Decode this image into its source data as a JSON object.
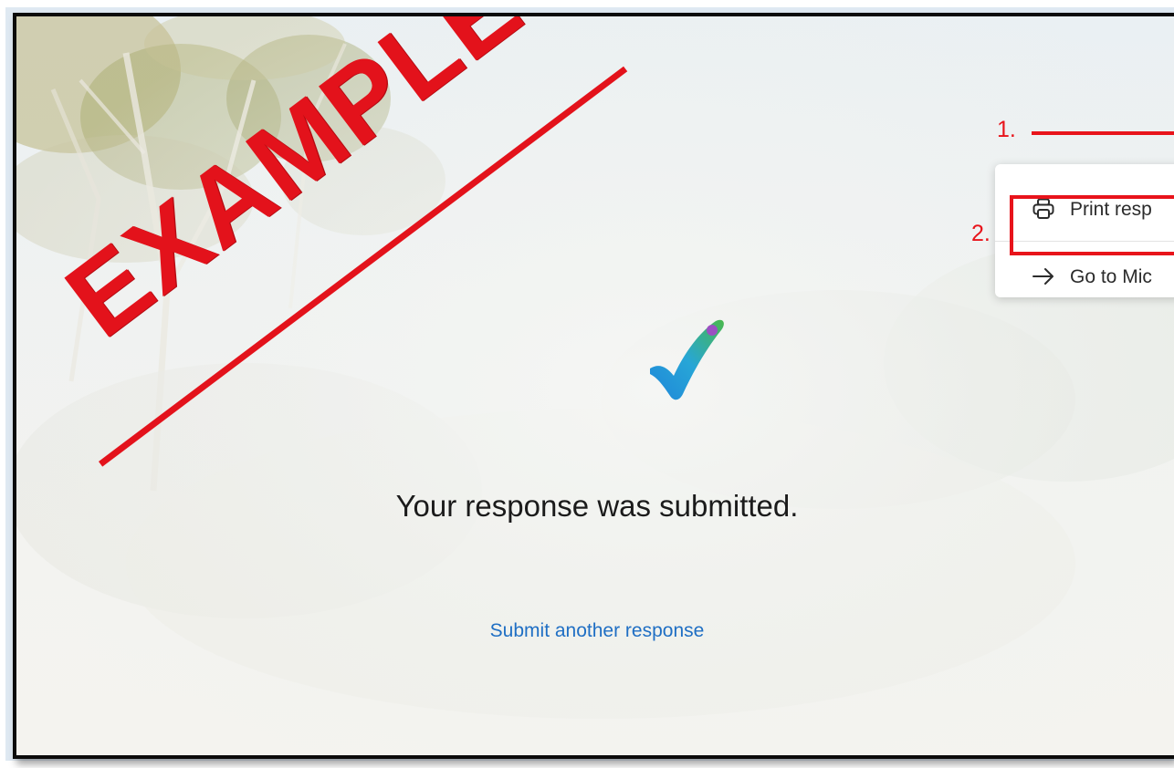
{
  "confirmation": {
    "message": "Your response was submitted.",
    "submit_another_link": "Submit another response"
  },
  "menu": {
    "items": [
      {
        "label": "Print resp",
        "icon": "printer-icon"
      },
      {
        "label": "Go to Mic",
        "icon": "arrow-right-icon"
      }
    ]
  },
  "annotations": {
    "step1": "1.",
    "step2": "2.",
    "watermark": "EXAMPLE"
  },
  "colors": {
    "annotation_red": "#e8141b",
    "link_blue": "#1f6fc4",
    "frame_blue": "#dfe9f2"
  }
}
